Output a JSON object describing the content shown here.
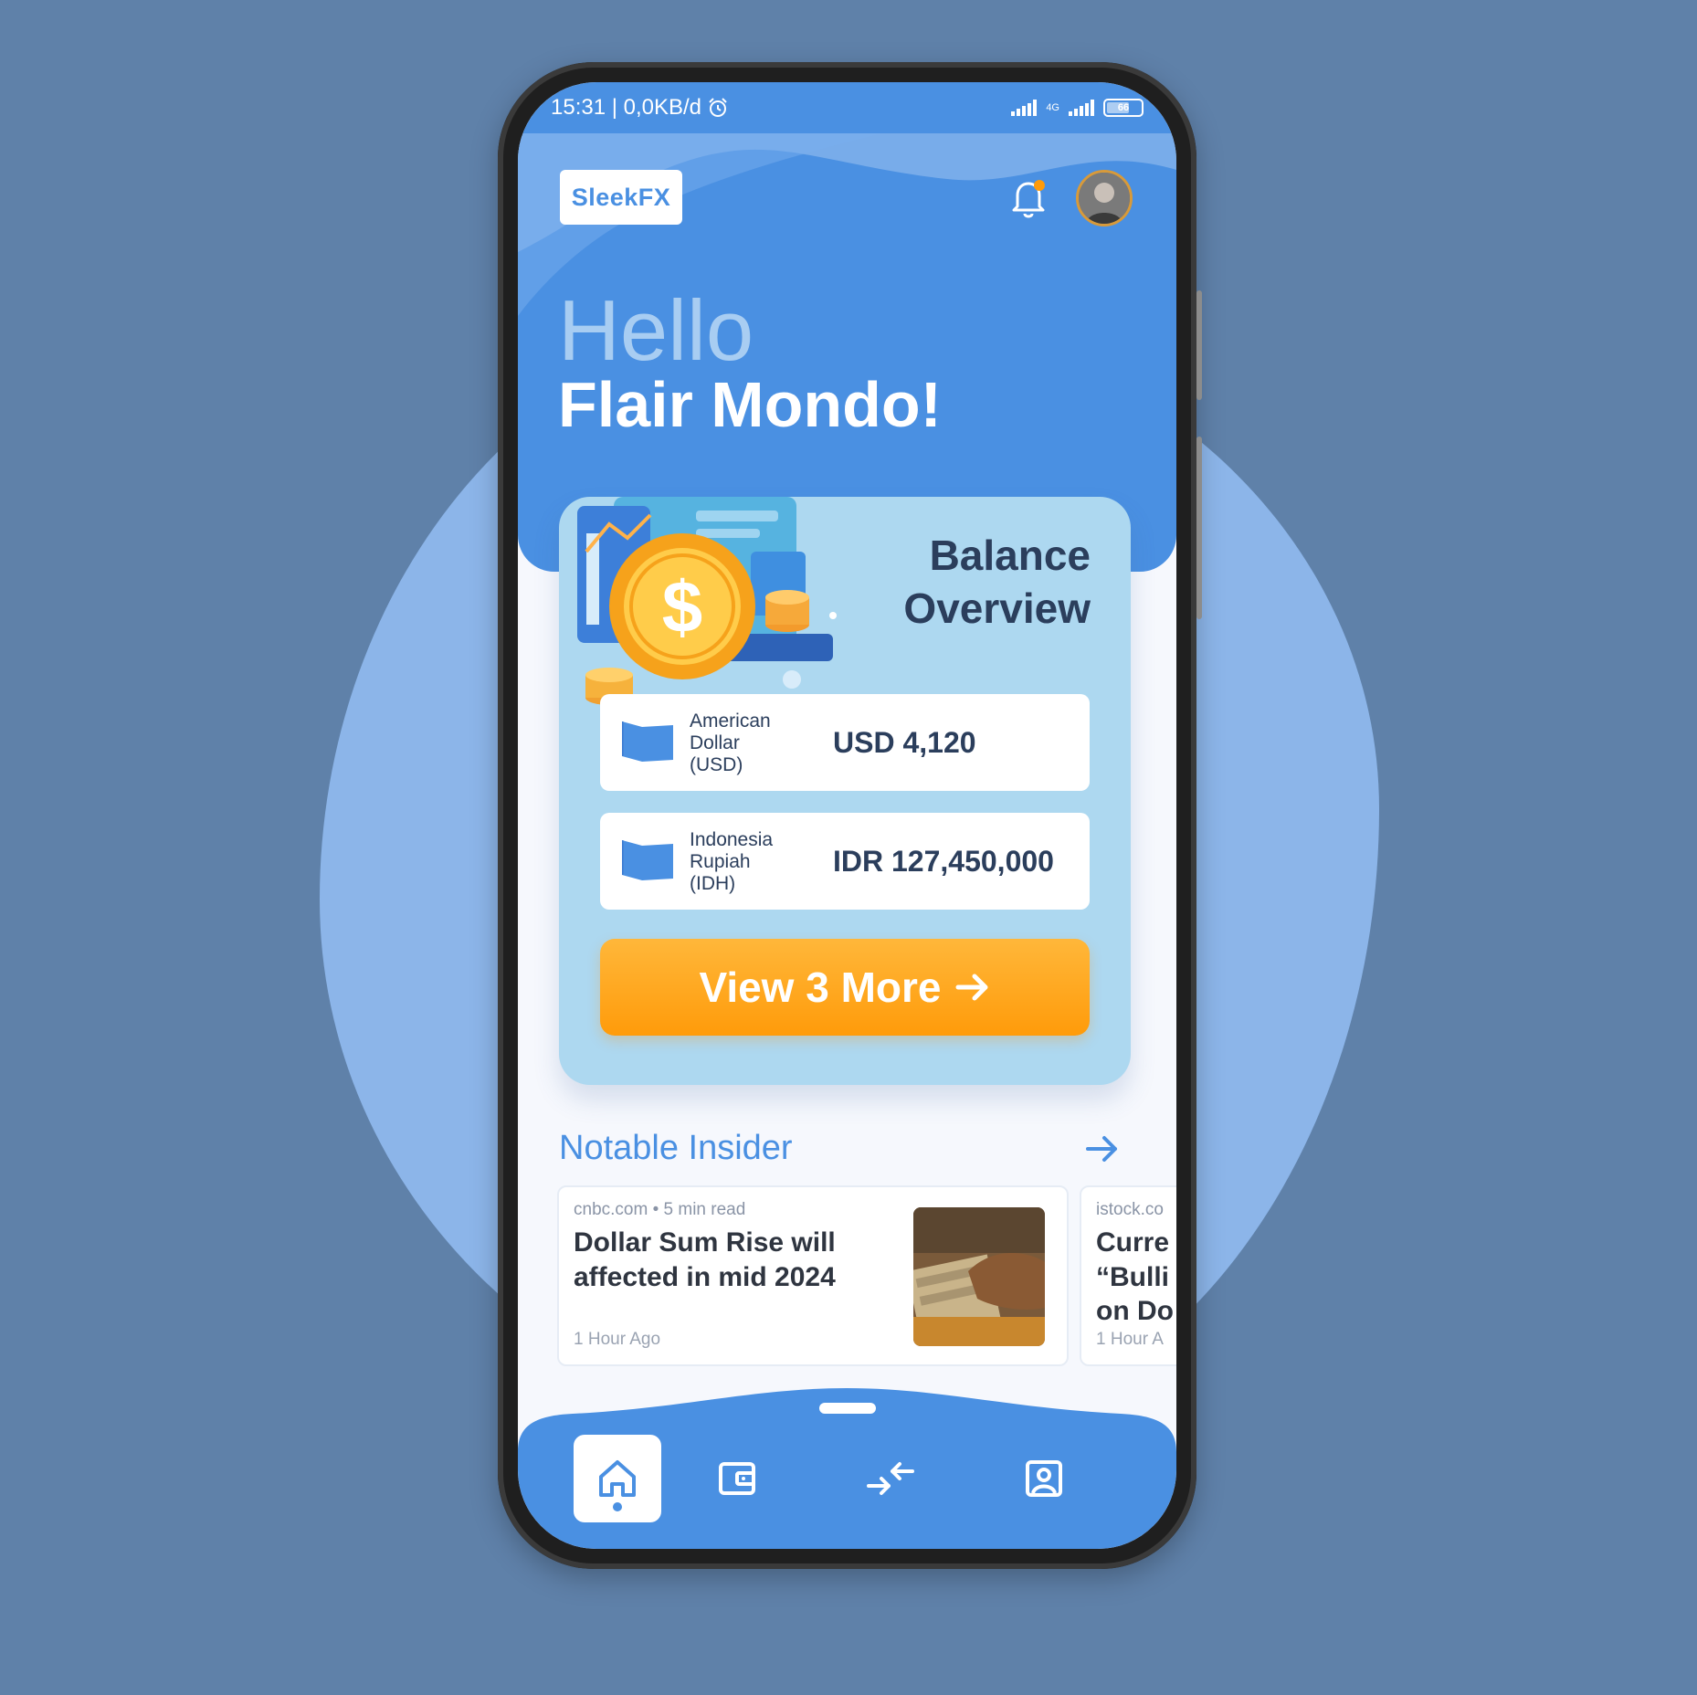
{
  "status_bar": {
    "time_speed": "15:31 | 0,0KB/d",
    "network": "4G",
    "battery": "66"
  },
  "header": {
    "logo_text": "SleekFX",
    "greeting": "Hello",
    "user_name": "Flair Mondo!"
  },
  "balance": {
    "title_line1": "Balance",
    "title_line2": "Overview",
    "accounts": [
      {
        "name_line1": "American",
        "name_line2": "Dollar",
        "name_line3": "(USD)",
        "value": "USD 4,120"
      },
      {
        "name_line1": "Indonesia",
        "name_line2": "Rupiah",
        "name_line3": "(IDH)",
        "value": "IDR 127,450,000"
      }
    ],
    "view_more_label": "View 3 More"
  },
  "insider": {
    "title": "Notable Insider",
    "articles": [
      {
        "source": "cnbc.com",
        "read_time": "5 min read",
        "title": "Dollar Sum Rise will affected in mid 2024",
        "time": "1 Hour Ago"
      },
      {
        "source": "istock.co",
        "title": "Curre “Bulli on Do",
        "time": "1 Hour A"
      }
    ]
  },
  "colors": {
    "primary": "#4a90e2",
    "accent": "#ff9b0a",
    "card": "#add8f0",
    "background": "#5f81a9"
  },
  "nav": {
    "items": [
      "home-icon",
      "wallet-icon",
      "exchange-icon",
      "profile-icon"
    ],
    "active_index": 0
  }
}
